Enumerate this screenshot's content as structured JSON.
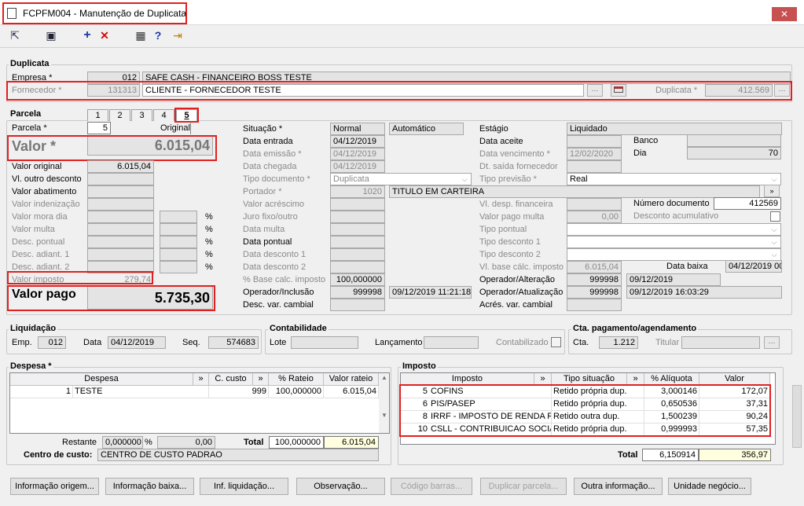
{
  "window": {
    "title": "FCPFM004 - Manutenção de Duplicata",
    "close": "✕"
  },
  "toolbar": {
    "nav": "⇱",
    "save": "▣",
    "add": "+",
    "delete": "✕",
    "calc": "▦",
    "help": "?",
    "exit": "⇥"
  },
  "duplicata": {
    "section": "Duplicata",
    "empresa_label": "Empresa *",
    "empresa_code": "012",
    "empresa_name": "SAFE CASH - FINANCEIRO BOSS TESTE",
    "fornecedor_label": "Fornecedor *",
    "fornecedor_code": "131313",
    "fornecedor_name": "CLIENTE - FORNECEDOR TESTE",
    "duplicata_label": "Duplicata *",
    "duplicata_value": "412.569"
  },
  "parcela": {
    "section": "Parcela",
    "tabs": [
      "1",
      "2",
      "3",
      "4",
      "5"
    ],
    "parcela_label": "Parcela *",
    "parcela_value": "5",
    "original_label": "Original",
    "valor_label": "Valor *",
    "valor_value": "6.015,04",
    "left_rows": [
      {
        "label": "Valor original",
        "value": "6.015,04",
        "pct": ""
      },
      {
        "label": "Vl. outro desconto",
        "value": "",
        "pct": ""
      },
      {
        "label": "Valor abatimento",
        "value": "",
        "pct": ""
      },
      {
        "label": "Valor indenização",
        "value": "",
        "pct": ""
      },
      {
        "label": "Valor mora dia",
        "value": "",
        "pct": "%"
      },
      {
        "label": "Valor multa",
        "value": "",
        "pct": "%"
      },
      {
        "label": "Desc. pontual",
        "value": "",
        "pct": "%"
      },
      {
        "label": "Desc. adiant. 1",
        "value": "",
        "pct": "%"
      },
      {
        "label": "Desc. adiant. 2",
        "value": "",
        "pct": "%"
      },
      {
        "label": "Valor imposto",
        "value": "279,74",
        "pct": ""
      }
    ],
    "valor_pago_label": "Valor pago",
    "valor_pago_value": "5.735,30",
    "mid_rows": [
      {
        "label": "Situação *",
        "value": "Normal",
        "extra": "Automático"
      },
      {
        "label": "Data entrada",
        "value": "04/12/2019"
      },
      {
        "label": "Data emissão *",
        "value": "04/12/2019"
      },
      {
        "label": "Data chegada",
        "value": "04/12/2019"
      },
      {
        "label": "Tipo documento *",
        "value": "Duplicata"
      },
      {
        "label": "Portador *",
        "value": "1020",
        "extra": "TITULO EM CARTEIRA"
      },
      {
        "label": "Valor acréscimo",
        "value": ""
      },
      {
        "label": "Juro fixo/outro",
        "value": ""
      },
      {
        "label": "Data multa",
        "value": ""
      },
      {
        "label": "Data pontual",
        "value": ""
      },
      {
        "label": "Data desconto 1",
        "value": ""
      },
      {
        "label": "Data desconto 2",
        "value": ""
      },
      {
        "label": "% Base calc. imposto",
        "value": "100,000000"
      },
      {
        "label": "Operador/Inclusão",
        "value": "999998",
        "extra": "09/12/2019 11:21:18"
      },
      {
        "label": "Desc. var. cambial",
        "value": ""
      }
    ],
    "right_rows": [
      {
        "label": "Estágio",
        "value": "Liquidado"
      },
      {
        "label": "Data aceite",
        "value": ""
      },
      {
        "label": "Data vencimento *",
        "value": "12/02/2020"
      },
      {
        "label": "Dt. saída fornecedor",
        "value": ""
      },
      {
        "label": "Tipo previsão *",
        "value": "Real"
      },
      {
        "label": "Vl. desp. financeira",
        "value": ""
      },
      {
        "label": "Valor pago multa",
        "value": "0,00"
      },
      {
        "label": "Tipo pontual",
        "value": ""
      },
      {
        "label": "Tipo desconto 1",
        "value": ""
      },
      {
        "label": "Tipo desconto 2",
        "value": ""
      },
      {
        "label": "Vl. base cálc. imposto",
        "value": "6.015,04"
      },
      {
        "label": "Operador/Alteração",
        "value": "999998",
        "extra": "09/12/2019"
      },
      {
        "label": "Operador/Atualização",
        "value": "999998",
        "extra": "09/12/2019 16:03:29"
      },
      {
        "label": "Acrés. var. cambial",
        "value": ""
      }
    ],
    "banco_label": "Banco",
    "banco_value": "",
    "dia_label": "Dia",
    "dia_value": "70",
    "numdoc_label": "Número documento",
    "numdoc_value": "412569",
    "descacum_label": "Desconto acumulativo",
    "databaixa_label": "Data baixa",
    "databaixa_value": "04/12/2019 00"
  },
  "liquidacao": {
    "section": "Liquidação",
    "emp_label": "Emp.",
    "emp_value": "012",
    "data_label": "Data",
    "data_value": "04/12/2019",
    "seq_label": "Seq.",
    "seq_value": "574683"
  },
  "contabilidade": {
    "section": "Contabilidade",
    "lote_label": "Lote",
    "lote_value": "",
    "lanc_label": "Lançamento",
    "lanc_value": "",
    "contab_label": "Contabilizado"
  },
  "cta": {
    "section": "Cta. pagamento/agendamento",
    "cta_label": "Cta.",
    "cta_value": "1.212",
    "titular_label": "Titular",
    "titular_value": ""
  },
  "despesa": {
    "section": "Despesa *",
    "columns": [
      "Despesa",
      "»",
      "C. custo",
      "»",
      "% Rateio",
      "Valor rateio"
    ],
    "rows": [
      {
        "num": "1",
        "name": "TESTE",
        "ccusto": "999",
        "rateio": "100,000000",
        "valor": "6.015,04"
      }
    ],
    "restante_label": "Restante",
    "restante_pct": "0,000000",
    "restante_pct_sign": "%",
    "restante_val": "0,00",
    "total_label": "Total",
    "total_pct": "100,000000",
    "total_val": "6.015,04",
    "cc_label": "Centro de custo:",
    "cc_value": "CENTRO DE CUSTO PADRAO"
  },
  "imposto": {
    "section": "Imposto",
    "columns": [
      "Imposto",
      "»",
      "Tipo situação",
      "»",
      "% Alíquota",
      "Valor"
    ],
    "rows": [
      {
        "num": "5",
        "name": "COFINS",
        "tipo": "Retido própria dup.",
        "aliq": "3,000146",
        "valor": "172,07"
      },
      {
        "num": "6",
        "name": "PIS/PASEP",
        "tipo": "Retido própria dup.",
        "aliq": "0,650536",
        "valor": "37,31"
      },
      {
        "num": "8",
        "name": "IRRF - IMPOSTO DE RENDA RET",
        "tipo": "Retido outra dup.",
        "aliq": "1,500239",
        "valor": "90,24"
      },
      {
        "num": "10",
        "name": "CSLL - CONTRIBUICAO SOCIAL",
        "tipo": "Retido própria dup.",
        "aliq": "0,999993",
        "valor": "57,35"
      }
    ],
    "total_label": "Total",
    "total_aliq": "6,150914",
    "total_valor": "356,97"
  },
  "buttons": [
    {
      "label": "Informação origem...",
      "enabled": true
    },
    {
      "label": "Informação baixa...",
      "enabled": true
    },
    {
      "label": "Inf. liquidação...",
      "enabled": true
    },
    {
      "label": "Observação...",
      "enabled": true
    },
    {
      "label": "Código barras...",
      "enabled": false
    },
    {
      "label": "Duplicar parcela...",
      "enabled": false
    },
    {
      "label": "Outra informação...",
      "enabled": true
    },
    {
      "label": "Unidade negócio...",
      "enabled": true
    }
  ]
}
